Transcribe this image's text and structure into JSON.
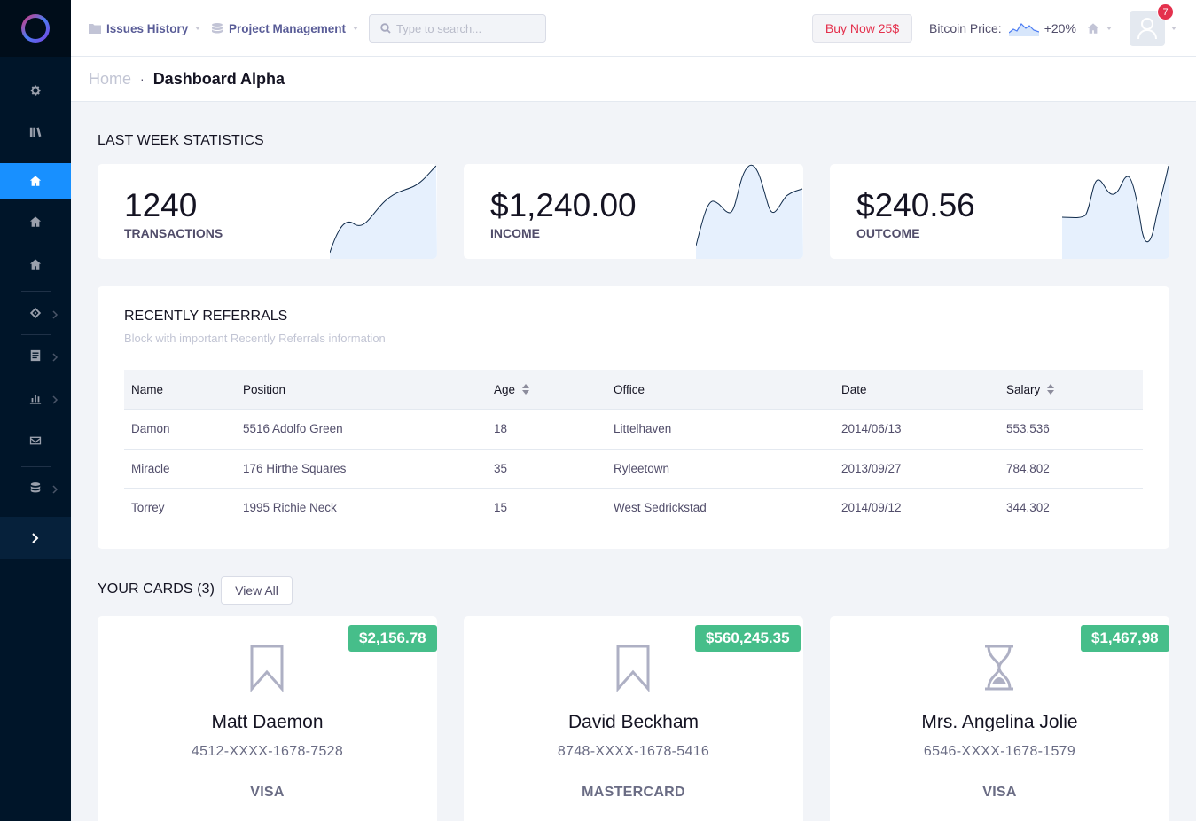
{
  "topbar": {
    "menu1": "Issues History",
    "menu2": "Project Management",
    "search_placeholder": "Type to search...",
    "buy_button": "Buy Now 25$",
    "bitcoin_label": "Bitcoin Price:",
    "bitcoin_change": "+20%",
    "notification_count": "7"
  },
  "breadcrumb": {
    "home": "Home",
    "separator": "·",
    "current": "Dashboard Alpha"
  },
  "stats": {
    "title": "LAST WEEK STATISTICS",
    "items": [
      {
        "value": "1240",
        "label": "TRANSACTIONS"
      },
      {
        "value": "$1,240.00",
        "label": "INCOME"
      },
      {
        "value": "$240.56",
        "label": "OUTCOME"
      }
    ]
  },
  "referrals": {
    "title": "RECENTLY REFERRALS",
    "subtitle": "Block with important Recently Referrals information",
    "columns": [
      "Name",
      "Position",
      "Age",
      "Office",
      "Date",
      "Salary"
    ],
    "rows": [
      [
        "Damon",
        "5516 Adolfo Green",
        "18",
        "Littelhaven",
        "2014/06/13",
        "553.536"
      ],
      [
        "Miracle",
        "176 Hirthe Squares",
        "35",
        "Ryleetown",
        "2013/09/27",
        "784.802"
      ],
      [
        "Torrey",
        "1995 Richie Neck",
        "15",
        "West Sedrickstad",
        "2014/09/12",
        "344.302"
      ]
    ]
  },
  "cards": {
    "title": "YOUR CARDS (3)",
    "view_all": "View All",
    "items": [
      {
        "amount": "$2,156.78",
        "name": "Matt Daemon",
        "number": "4512-XXXX-1678-7528",
        "type": "VISA",
        "icon": "bookmark-icon"
      },
      {
        "amount": "$560,245.35",
        "name": "David Beckham",
        "number": "8748-XXXX-1678-5416",
        "type": "MASTERCARD",
        "icon": "bookmark-icon"
      },
      {
        "amount": "$1,467,98",
        "name": "Mrs. Angelina Jolie",
        "number": "6546-XXXX-1678-1579",
        "type": "VISA",
        "icon": "hourglass-icon"
      }
    ]
  },
  "colors": {
    "sidebar": "#001529",
    "accent": "#1890ff",
    "badge": "#46be8a",
    "danger": "#e4314d"
  }
}
